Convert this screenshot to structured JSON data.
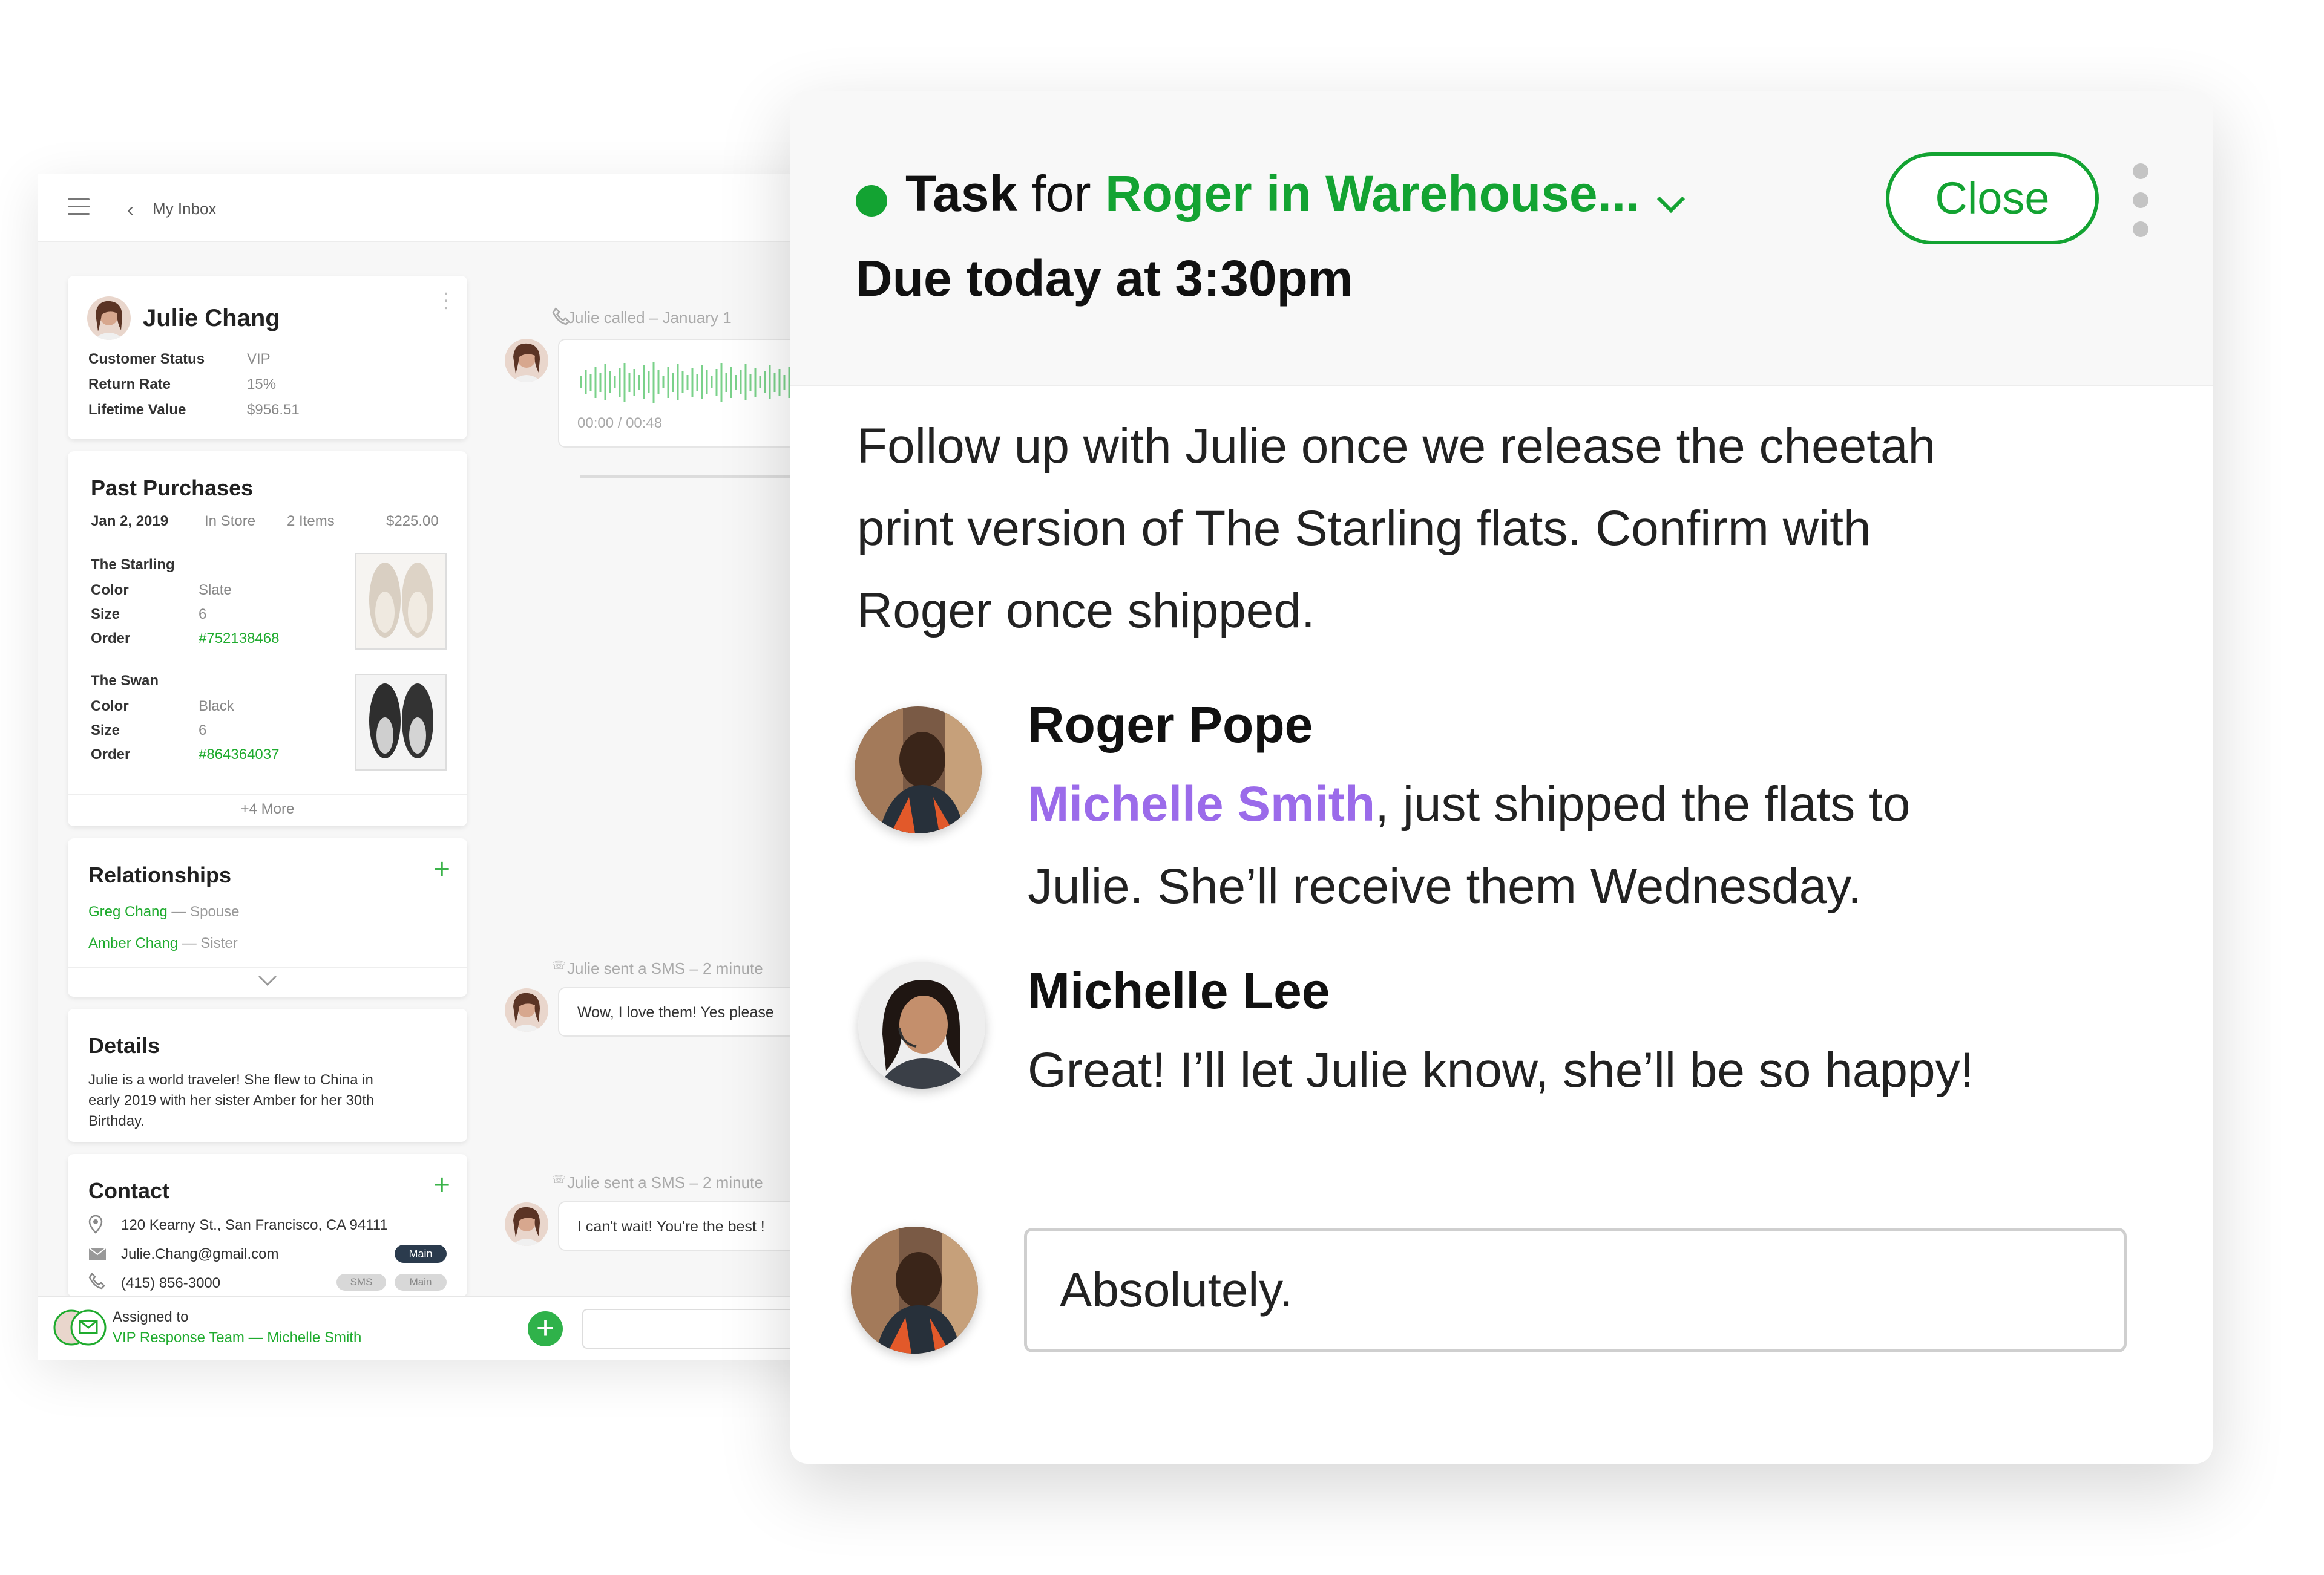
{
  "inbox": {
    "title": "My Inbox",
    "customer": {
      "name": "Julie Chang",
      "fields": [
        {
          "label": "Customer Status",
          "value": "VIP"
        },
        {
          "label": "Return Rate",
          "value": "15%"
        },
        {
          "label": "Lifetime Value",
          "value": "$956.51"
        }
      ]
    },
    "past_purchases": {
      "title": "Past Purchases",
      "date": "Jan 2, 2019",
      "channel": "In Store",
      "items": "2 Items",
      "total": "$225.00",
      "products": [
        {
          "name": "The Starling",
          "color_label": "Color",
          "color": "Slate",
          "size_label": "Size",
          "size": "6",
          "order_label": "Order",
          "order": "#752138468"
        },
        {
          "name": "The Swan",
          "color_label": "Color",
          "color": "Black",
          "size_label": "Size",
          "size": "6",
          "order_label": "Order",
          "order": "#864364037"
        }
      ],
      "more": "+4 More"
    },
    "relationships": {
      "title": "Relationships",
      "items": [
        {
          "name": "Greg Chang",
          "rel": "— Spouse"
        },
        {
          "name": "Amber Chang",
          "rel": "— Sister"
        }
      ]
    },
    "details": {
      "title": "Details",
      "lines": [
        "Julie is a world traveler! She flew to China in",
        "early 2019 with her sister Amber for her 30th",
        "Birthday."
      ]
    },
    "contact": {
      "title": "Contact",
      "address": "120 Kearny St., San Francisco, CA 94111",
      "email": "Julie.Chang@gmail.com",
      "email_badge": "Main",
      "phone": "(415) 856-3000",
      "phone_badge_sms": "SMS",
      "phone_badge_main": "Main"
    },
    "assigned": {
      "label": "Assigned to",
      "value": "VIP Response Team — Michelle Smith"
    },
    "chat": {
      "call_meta": "Julie called – January 1",
      "call_time": "00:00 / 00:48",
      "sms1_meta": "Julie sent a SMS – 2 minute",
      "sms1_text": "Wow, I love them! Yes please",
      "sms2_meta": "Julie sent a SMS – 2 minute",
      "sms2_text": "I can't wait! You're the best !"
    }
  },
  "task": {
    "kind": "Task",
    "for_word": "for",
    "assignee": "Roger in Warehouse...",
    "due": "Due today at 3:30pm",
    "close_label": "Close",
    "body_lines": [
      "Follow up with Julie once we release the cheetah",
      "print version of The Starling flats. Confirm with",
      "Roger once shipped."
    ],
    "comments": [
      {
        "author": "Roger Pope",
        "mention": "Michelle Smith",
        "line1_rest": ", just shipped the flats to",
        "line2": "Julie. She’ll receive them Wednesday."
      },
      {
        "author": "Michelle Lee",
        "line1": "Great! I’ll let Julie know, she’ll be so happy!"
      }
    ],
    "reply_value": "Absolutely.",
    "colors": {
      "accent": "#13a332",
      "mention": "#9b6bea"
    }
  }
}
